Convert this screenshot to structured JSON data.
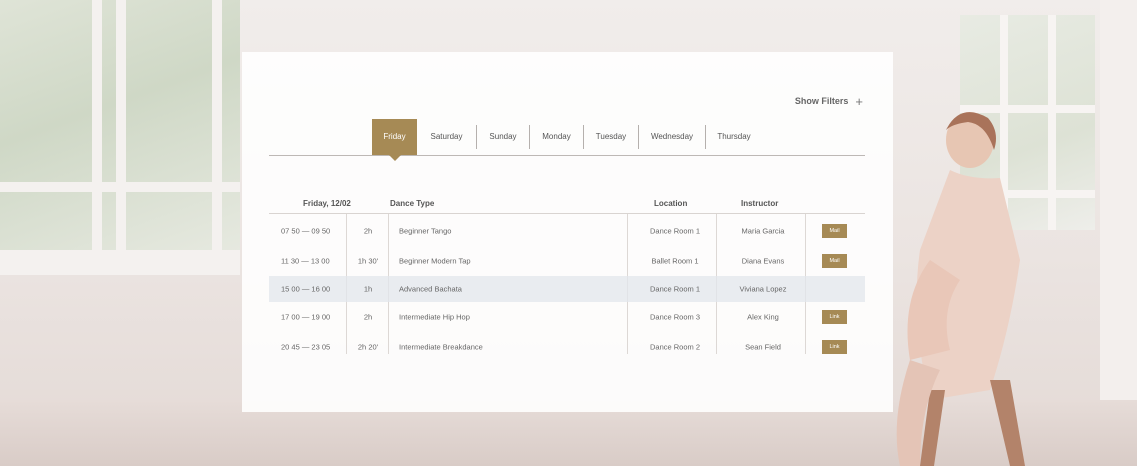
{
  "filters": {
    "label": "Show Filters",
    "icon": "plus-icon"
  },
  "days": [
    {
      "label": "Friday",
      "active": true
    },
    {
      "label": "Saturday",
      "active": false
    },
    {
      "label": "Sunday",
      "active": false
    },
    {
      "label": "Monday",
      "active": false
    },
    {
      "label": "Tuesday",
      "active": false
    },
    {
      "label": "Wednesday",
      "active": false
    },
    {
      "label": "Thursday",
      "active": false
    }
  ],
  "schedule": {
    "headers": {
      "date": "Friday, 12/02",
      "dance": "Dance Type",
      "location": "Location",
      "instructor": "Instructor"
    },
    "rows": [
      {
        "time": "07 50 — 09 50",
        "duration": "2h",
        "dance": "Beginner Tango",
        "location": "Dance Room 1",
        "instructor": "Maria Garcia",
        "action": "Mail"
      },
      {
        "time": "11 30 — 13 00",
        "duration": "1h 30'",
        "dance": "Beginner Modern Tap",
        "location": "Ballet Room 1",
        "instructor": "Diana Evans",
        "action": "Mail"
      },
      {
        "time": "15 00 — 16 00",
        "duration": "1h",
        "dance": "Advanced Bachata",
        "location": "Dance Room 1",
        "instructor": "Viviana Lopez",
        "action": ""
      },
      {
        "time": "17 00 — 19 00",
        "duration": "2h",
        "dance": "Intermediate Hip Hop",
        "location": "Dance Room 3",
        "instructor": "Alex King",
        "action": "Link"
      },
      {
        "time": "20 45 — 23 05",
        "duration": "2h 20'",
        "dance": "Intermediate Breakdance",
        "location": "Dance Room 2",
        "instructor": "Sean Field",
        "action": "Link"
      }
    ]
  },
  "colors": {
    "accent": "#a68a55",
    "highlight_row": "#e2e7ec",
    "panel": "#ffffff"
  }
}
